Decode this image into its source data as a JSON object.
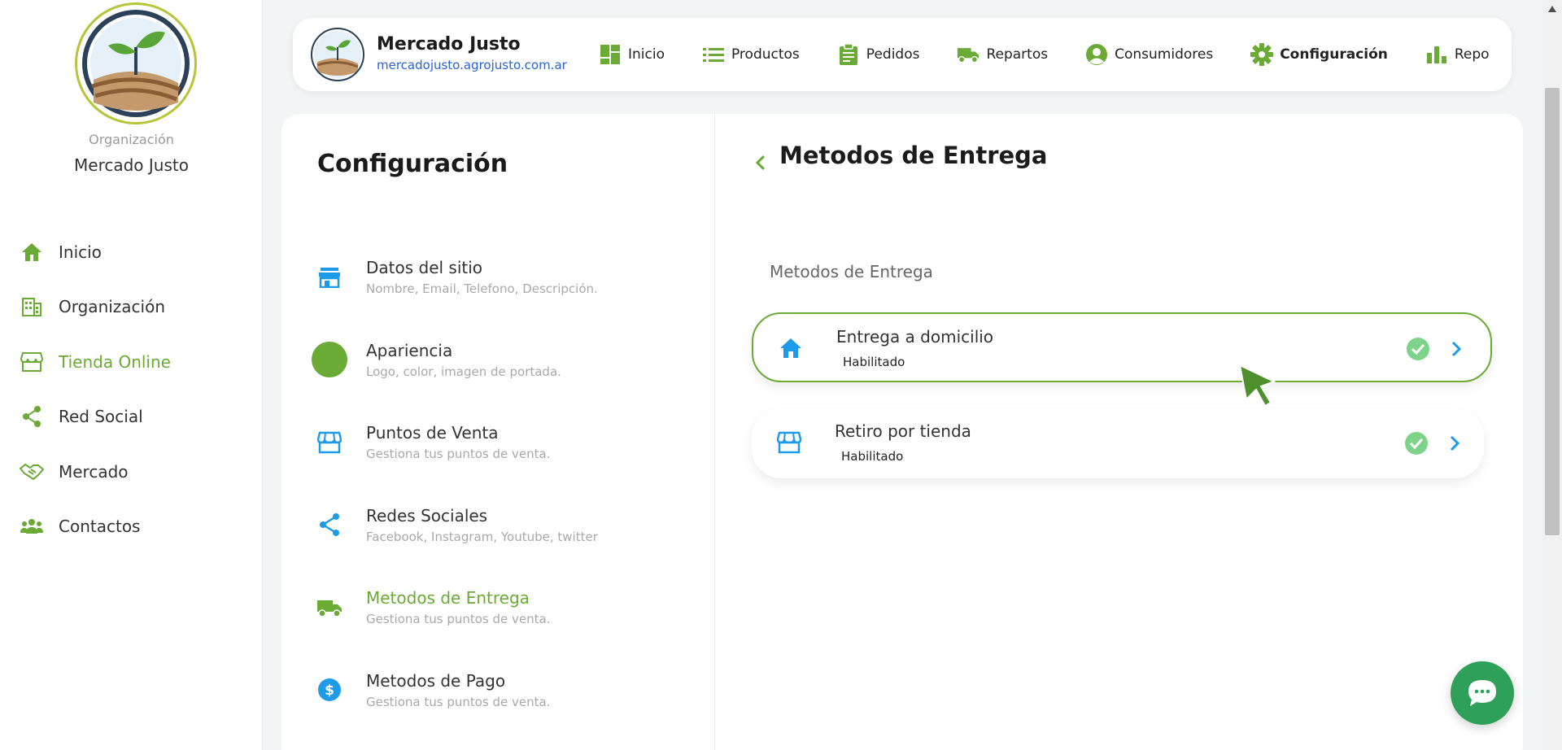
{
  "sidebar": {
    "org_caption": "Organización",
    "org_name": "Mercado Justo",
    "items": [
      {
        "label": "Inicio",
        "icon": "home-icon"
      },
      {
        "label": "Organización",
        "icon": "building-icon"
      },
      {
        "label": "Tienda Online",
        "icon": "store-icon"
      },
      {
        "label": "Red Social",
        "icon": "share-icon"
      },
      {
        "label": "Mercado",
        "icon": "handshake-icon"
      },
      {
        "label": "Contactos",
        "icon": "people-icon"
      }
    ],
    "active_item": "Tienda Online"
  },
  "header": {
    "brand_name": "Mercado Justo",
    "brand_url": "mercadojusto.agrojusto.com.ar",
    "nav": [
      {
        "label": "Inicio",
        "icon": "dashboard-icon"
      },
      {
        "label": "Productos",
        "icon": "list-icon"
      },
      {
        "label": "Pedidos",
        "icon": "clipboard-icon"
      },
      {
        "label": "Repartos",
        "icon": "truck-icon"
      },
      {
        "label": "Consumidores",
        "icon": "user-circle-icon"
      },
      {
        "label": "Configuración",
        "icon": "gear-icon"
      },
      {
        "label": "Repo",
        "icon": "bar-chart-icon"
      }
    ],
    "active_nav": "Configuración"
  },
  "config": {
    "title": "Configuración",
    "items": [
      {
        "title": "Datos del sitio",
        "subtitle": "Nombre, Email, Telefono, Descripción.",
        "icon": "storefront-icon"
      },
      {
        "title": "Apariencia",
        "subtitle": "Logo, color, imagen de portada.",
        "icon": "color-swatch-icon"
      },
      {
        "title": "Puntos de Venta",
        "subtitle": "Gestiona tus puntos de venta.",
        "icon": "shop-icon"
      },
      {
        "title": "Redes Sociales",
        "subtitle": "Facebook, Instagram, Youtube, twitter",
        "icon": "share-icon"
      },
      {
        "title": "Metodos de Entrega",
        "subtitle": "Gestiona tus puntos de venta.",
        "icon": "truck-icon"
      },
      {
        "title": "Metodos de Pago",
        "subtitle": "Gestiona tus puntos de venta.",
        "icon": "dollar-icon"
      }
    ],
    "active_item": "Metodos de Entrega"
  },
  "panel": {
    "title": "Metodos de Entrega",
    "section_label": "Metodos de Entrega",
    "methods": [
      {
        "title": "Entrega a domicilio",
        "status": "Habilitado",
        "icon": "home-icon",
        "selected": true
      },
      {
        "title": "Retiro por tienda",
        "status": "Habilitado",
        "icon": "shop-icon",
        "selected": false
      }
    ]
  },
  "colors": {
    "brand_green": "#6aaa35",
    "icon_blue": "#1e9be8",
    "check_green": "#7dd389",
    "chat_green": "#2fa05a",
    "link_blue": "#2b62d4"
  }
}
